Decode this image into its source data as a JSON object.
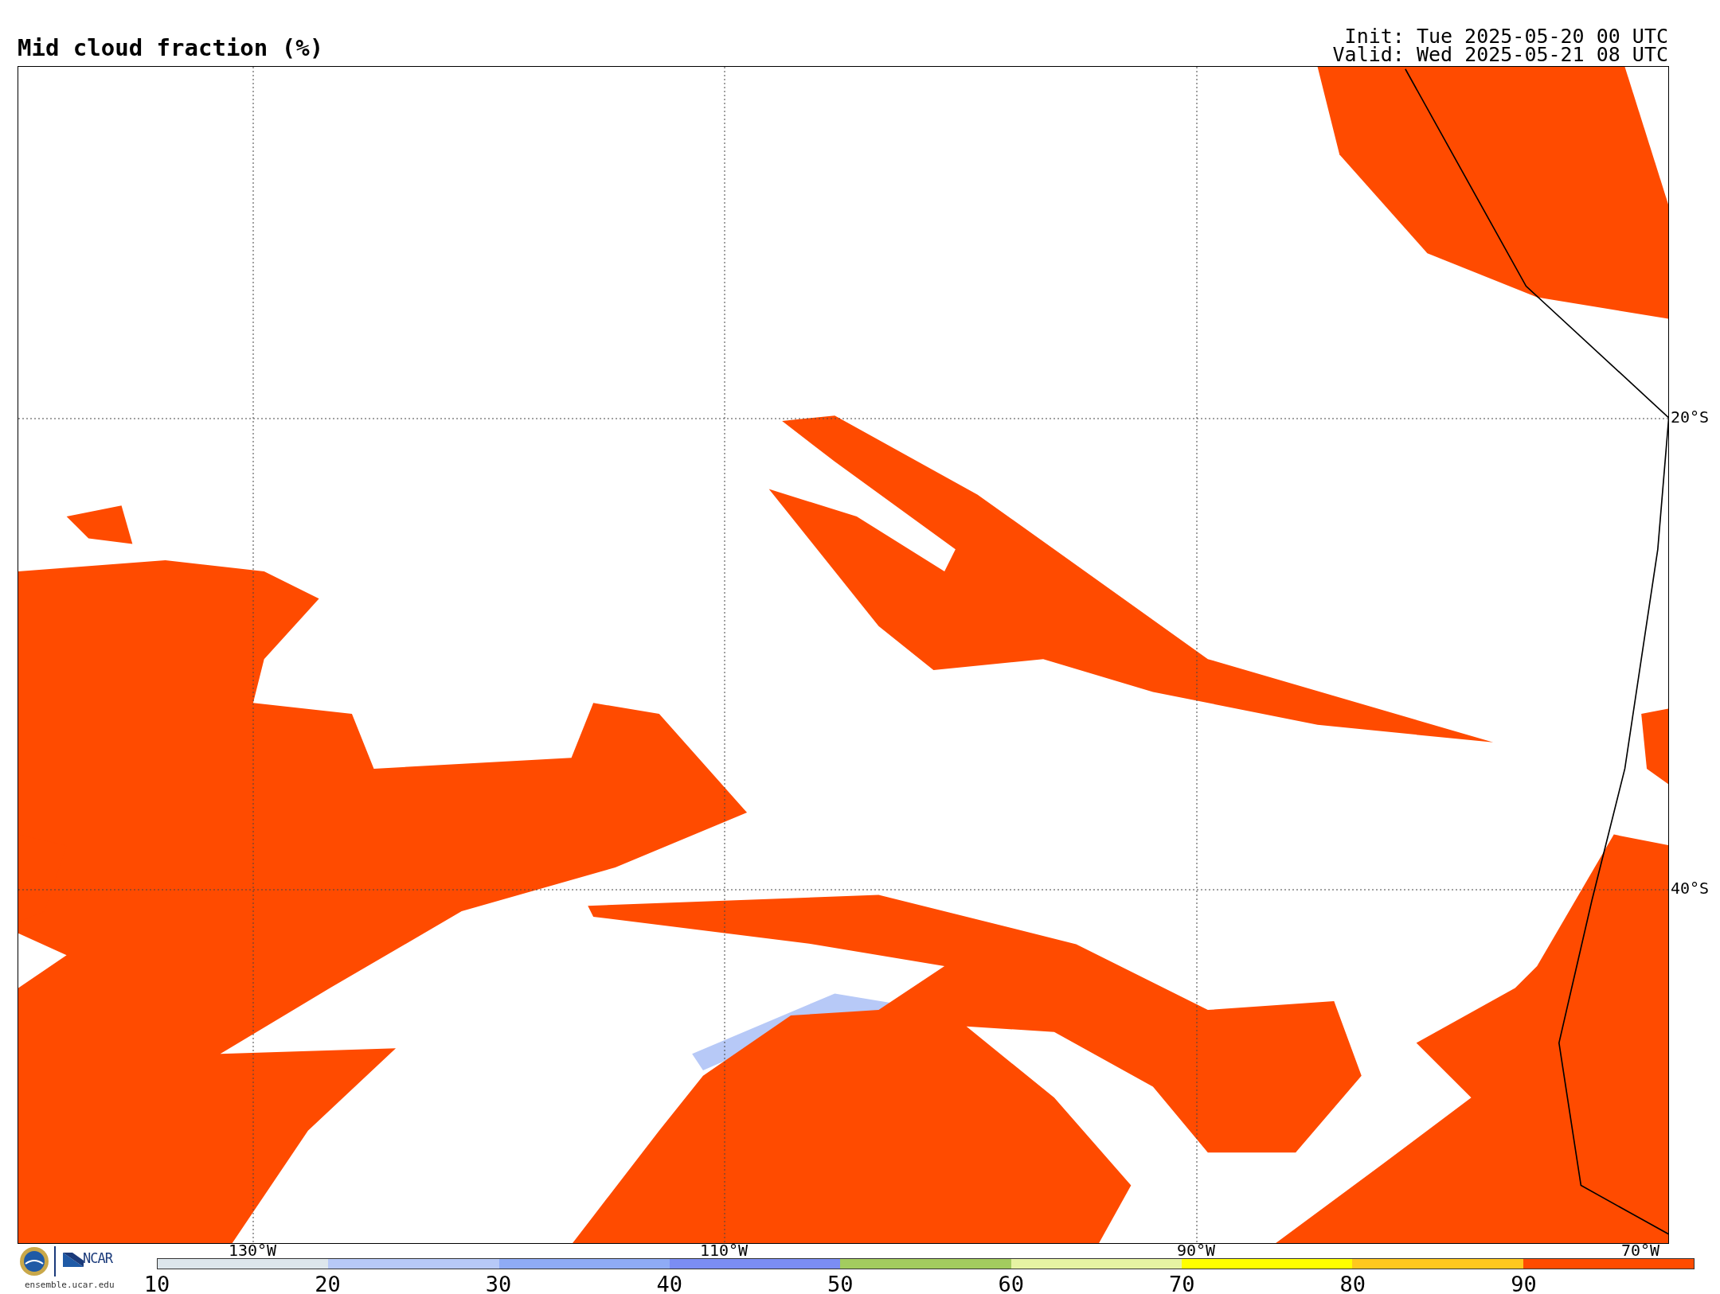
{
  "title": "Mid cloud fraction (%)",
  "init": "Init: Tue 2025-05-20 00 UTC",
  "valid": "Valid: Wed 2025-05-21 08 UTC",
  "map": {
    "lat_labels": [
      "20°S",
      "40°S"
    ],
    "lon_labels": [
      "130°W",
      "110°W",
      "90°W",
      "70°W"
    ]
  },
  "colorbar": {
    "segments": [
      {
        "color": "#dde6ec"
      },
      {
        "color": "#b7c9f7"
      },
      {
        "color": "#8fabf5"
      },
      {
        "color": "#7b8df3"
      },
      {
        "color": "#a3cc5f"
      },
      {
        "color": "#e6f3a3"
      },
      {
        "color": "#ffff00"
      },
      {
        "color": "#ffc81e"
      },
      {
        "color": "#ff4b00"
      }
    ],
    "ticks": [
      "10",
      "20",
      "30",
      "40",
      "50",
      "60",
      "70",
      "80",
      "90"
    ]
  },
  "footer": {
    "logo_text": "NCAR",
    "site": "ensemble.ucar.edu"
  }
}
